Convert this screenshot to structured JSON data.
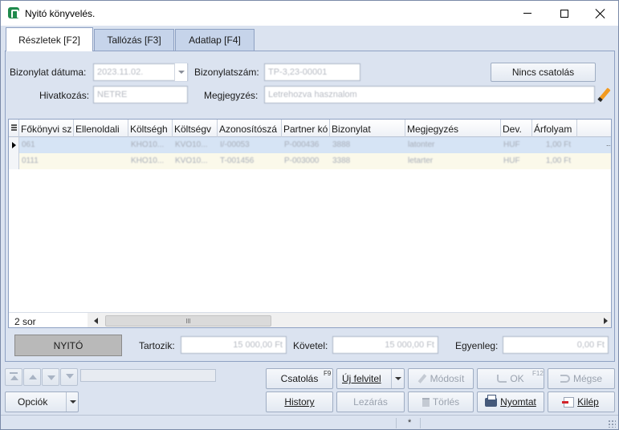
{
  "window": {
    "title": "Nyitó könyvelés."
  },
  "tabs": [
    {
      "label": "Részletek [F2]",
      "active": true
    },
    {
      "label": "Tallózás [F3]",
      "active": false
    },
    {
      "label": "Adatlap [F4]",
      "active": false
    }
  ],
  "form": {
    "date_label": "Bizonylat dátuma:",
    "date_value": "2023.11.02.",
    "docnum_label": "Bizonylatszám:",
    "docnum_value": "TP-3,23-00001",
    "ref_label": "Hivatkozás:",
    "ref_value": "NETRE",
    "note_label": "Megjegyzés:",
    "note_value": "Letrehozva hasznalom",
    "attachment_button": "Nincs csatolás"
  },
  "grid": {
    "columns": [
      "Főkönyvi sz",
      "Ellenoldali",
      "Költségh",
      "Költségv",
      "Azonosítószá",
      "Partner kó",
      "Bizonylat",
      "Megjegyzés",
      "Dev.",
      "Árfolyam"
    ],
    "rows": [
      [
        "061",
        "",
        "KHO10...",
        "KVO10...",
        "I/-00053",
        "P-000436",
        "3888",
        "latonter",
        "HUF",
        "1,00 Ft"
      ],
      [
        "0111",
        "",
        "KHO10...",
        "KVO10...",
        "T-001456",
        "P-003000",
        "3388",
        "letarter",
        "HUF",
        "1,00 Ft"
      ]
    ],
    "row_count": "2 sor",
    "more": "..."
  },
  "totals": {
    "type_label": "NYITÓ",
    "debit_label": "Tartozik:",
    "debit_value": "15 000,00 Ft",
    "credit_label": "Követel:",
    "credit_value": "15 000,00 Ft",
    "balance_label": "Egyenleg:",
    "balance_value": "0,00 Ft"
  },
  "toolbar": {
    "csatolas": "Csatolás",
    "csatolas_key": "F9",
    "uj_felvitel": "Új felvitel",
    "modosit": "Módosít",
    "ok": "OK",
    "ok_key": "F12",
    "megse": "Mégse",
    "opciok": "Opciók",
    "history": "History",
    "lezaras": "Lezárás",
    "torles": "Törlés",
    "nyomtat": "Nyomtat",
    "kilep": "Kilép"
  },
  "statusbar": {
    "marker": "*"
  }
}
